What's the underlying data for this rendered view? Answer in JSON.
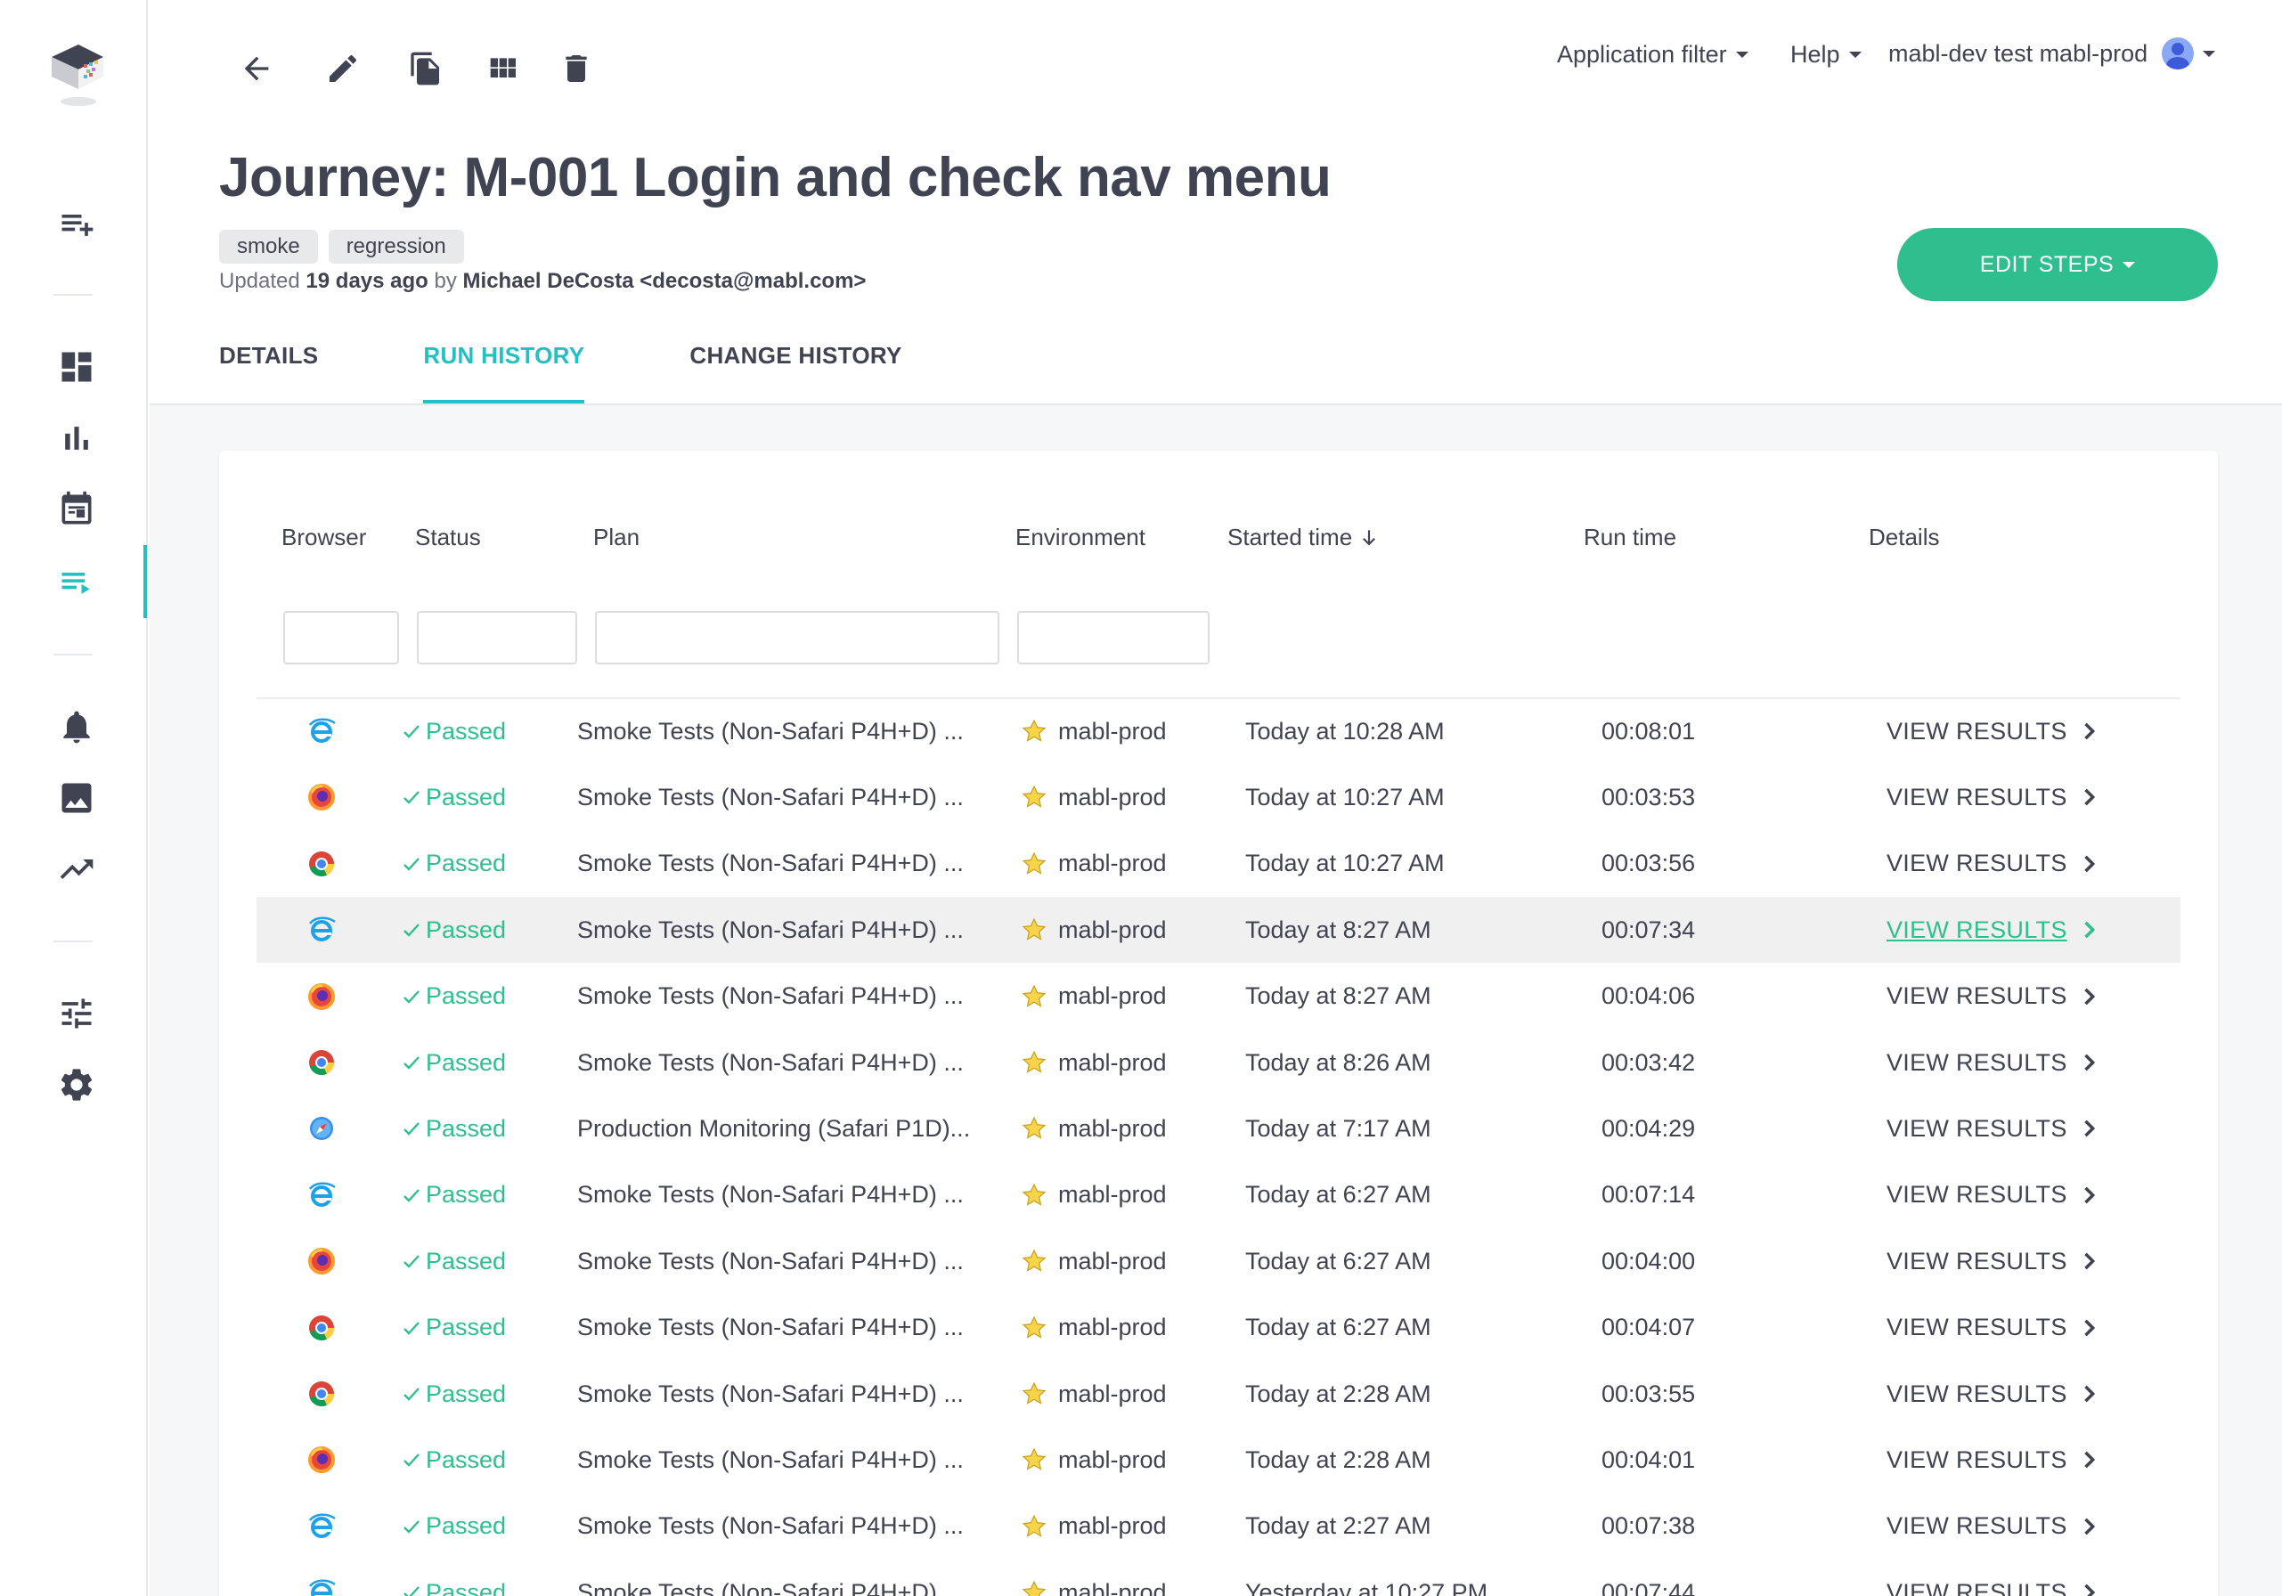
{
  "header": {
    "application_filter": "Application filter",
    "help": "Help",
    "user": "mabl-dev test mabl-prod"
  },
  "journey": {
    "title": "Journey: M-001 Login and check nav menu",
    "tags": [
      "smoke",
      "regression"
    ],
    "updated_prefix": "Updated",
    "updated_when": "19 days ago",
    "updated_by_prefix": "by",
    "updated_by": "Michael DeCosta <decosta@mabl.com>",
    "edit_steps_label": "EDIT STEPS"
  },
  "tabs": [
    {
      "label": "DETAILS",
      "active": false
    },
    {
      "label": "RUN HISTORY",
      "active": true
    },
    {
      "label": "CHANGE HISTORY",
      "active": false
    }
  ],
  "table": {
    "columns": [
      "Browser",
      "Status",
      "Plan",
      "Environment",
      "Started time",
      "Run time",
      "Details"
    ],
    "sort_column": "Started time",
    "sort_direction": "descending",
    "rows": [
      {
        "browser": "ie",
        "status": "Passed",
        "plan": "Smoke Tests (Non-Safari P4H+D) ...",
        "env": "mabl-prod",
        "started": "Today at 10:28 AM",
        "runtime": "00:08:01",
        "details": "VIEW RESULTS",
        "hover": false
      },
      {
        "browser": "firefox",
        "status": "Passed",
        "plan": "Smoke Tests (Non-Safari P4H+D) ...",
        "env": "mabl-prod",
        "started": "Today at 10:27 AM",
        "runtime": "00:03:53",
        "details": "VIEW RESULTS",
        "hover": false
      },
      {
        "browser": "chrome",
        "status": "Passed",
        "plan": "Smoke Tests (Non-Safari P4H+D) ...",
        "env": "mabl-prod",
        "started": "Today at 10:27 AM",
        "runtime": "00:03:56",
        "details": "VIEW RESULTS",
        "hover": false
      },
      {
        "browser": "ie",
        "status": "Passed",
        "plan": "Smoke Tests (Non-Safari P4H+D) ...",
        "env": "mabl-prod",
        "started": "Today at 8:27 AM",
        "runtime": "00:07:34",
        "details": "VIEW RESULTS",
        "hover": true
      },
      {
        "browser": "firefox",
        "status": "Passed",
        "plan": "Smoke Tests (Non-Safari P4H+D) ...",
        "env": "mabl-prod",
        "started": "Today at 8:27 AM",
        "runtime": "00:04:06",
        "details": "VIEW RESULTS",
        "hover": false
      },
      {
        "browser": "chrome",
        "status": "Passed",
        "plan": "Smoke Tests (Non-Safari P4H+D) ...",
        "env": "mabl-prod",
        "started": "Today at 8:26 AM",
        "runtime": "00:03:42",
        "details": "VIEW RESULTS",
        "hover": false
      },
      {
        "browser": "safari",
        "status": "Passed",
        "plan": "Production Monitoring (Safari P1D)...",
        "env": "mabl-prod",
        "started": "Today at 7:17 AM",
        "runtime": "00:04:29",
        "details": "VIEW RESULTS",
        "hover": false
      },
      {
        "browser": "ie",
        "status": "Passed",
        "plan": "Smoke Tests (Non-Safari P4H+D) ...",
        "env": "mabl-prod",
        "started": "Today at 6:27 AM",
        "runtime": "00:07:14",
        "details": "VIEW RESULTS",
        "hover": false
      },
      {
        "browser": "firefox",
        "status": "Passed",
        "plan": "Smoke Tests (Non-Safari P4H+D) ...",
        "env": "mabl-prod",
        "started": "Today at 6:27 AM",
        "runtime": "00:04:00",
        "details": "VIEW RESULTS",
        "hover": false
      },
      {
        "browser": "chrome",
        "status": "Passed",
        "plan": "Smoke Tests (Non-Safari P4H+D) ...",
        "env": "mabl-prod",
        "started": "Today at 6:27 AM",
        "runtime": "00:04:07",
        "details": "VIEW RESULTS",
        "hover": false
      },
      {
        "browser": "chrome",
        "status": "Passed",
        "plan": "Smoke Tests (Non-Safari P4H+D) ...",
        "env": "mabl-prod",
        "started": "Today at 2:28 AM",
        "runtime": "00:03:55",
        "details": "VIEW RESULTS",
        "hover": false
      },
      {
        "browser": "firefox",
        "status": "Passed",
        "plan": "Smoke Tests (Non-Safari P4H+D) ...",
        "env": "mabl-prod",
        "started": "Today at 2:28 AM",
        "runtime": "00:04:01",
        "details": "VIEW RESULTS",
        "hover": false
      },
      {
        "browser": "ie",
        "status": "Passed",
        "plan": "Smoke Tests (Non-Safari P4H+D) ...",
        "env": "mabl-prod",
        "started": "Today at 2:27 AM",
        "runtime": "00:07:38",
        "details": "VIEW RESULTS",
        "hover": false
      },
      {
        "browser": "ie",
        "status": "Passed",
        "plan": "Smoke Tests (Non-Safari P4H+D) ...",
        "env": "mabl-prod",
        "started": "Yesterday at 10:27 PM",
        "runtime": "00:07:44",
        "details": "VIEW RESULTS",
        "hover": false
      }
    ]
  },
  "colors": {
    "accent": "#22bfc4",
    "success": "#2fbf8e",
    "text": "#3f4352"
  },
  "icons": {
    "sidebar": [
      "create-icon",
      "dashboard-icon",
      "insights-icon",
      "calendar-icon",
      "journeys-icon",
      "notifications-icon",
      "image-icon",
      "trend-icon",
      "tune-icon",
      "settings-icon"
    ],
    "toolbar": [
      "back-icon",
      "edit-icon",
      "copy-icon",
      "grid-icon",
      "delete-icon"
    ]
  }
}
